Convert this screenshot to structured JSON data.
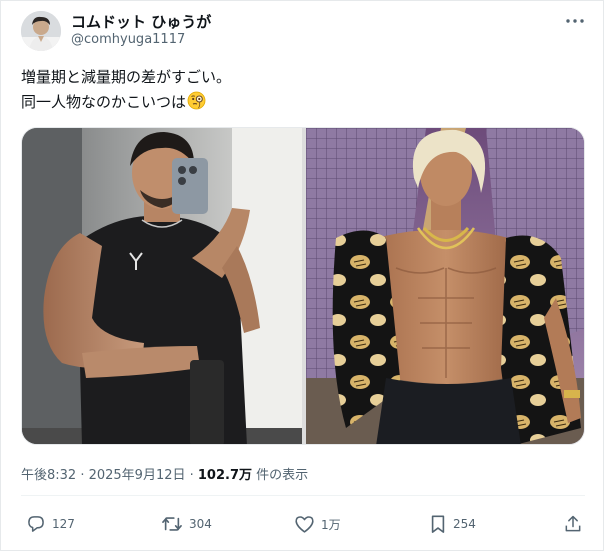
{
  "author": {
    "display_name": "コムドット ひゅうが",
    "handle": "@comhyuga1117",
    "avatar_icon": "profile-photo"
  },
  "post": {
    "text_lines": [
      "増量期と減量期の差がすごい。",
      "同一人物なのかこいつは"
    ],
    "emoji_icon": "face-with-monocle-emoji",
    "media": [
      {
        "icon": "mirror-selfie-photo-bulking"
      },
      {
        "icon": "shirtless-photo-cutting"
      }
    ]
  },
  "meta": {
    "timestamp": "午後8:32 · 2025年9月12日 · ",
    "views_count": "102.7万",
    "views_suffix": " 件の表示"
  },
  "actions": {
    "reply_count": "127",
    "repost_count": "304",
    "like_count": "1万",
    "bookmark_count": "254"
  },
  "colors": {
    "text": "#0f1419",
    "secondary": "#536471",
    "divider": "#eff3f4"
  }
}
